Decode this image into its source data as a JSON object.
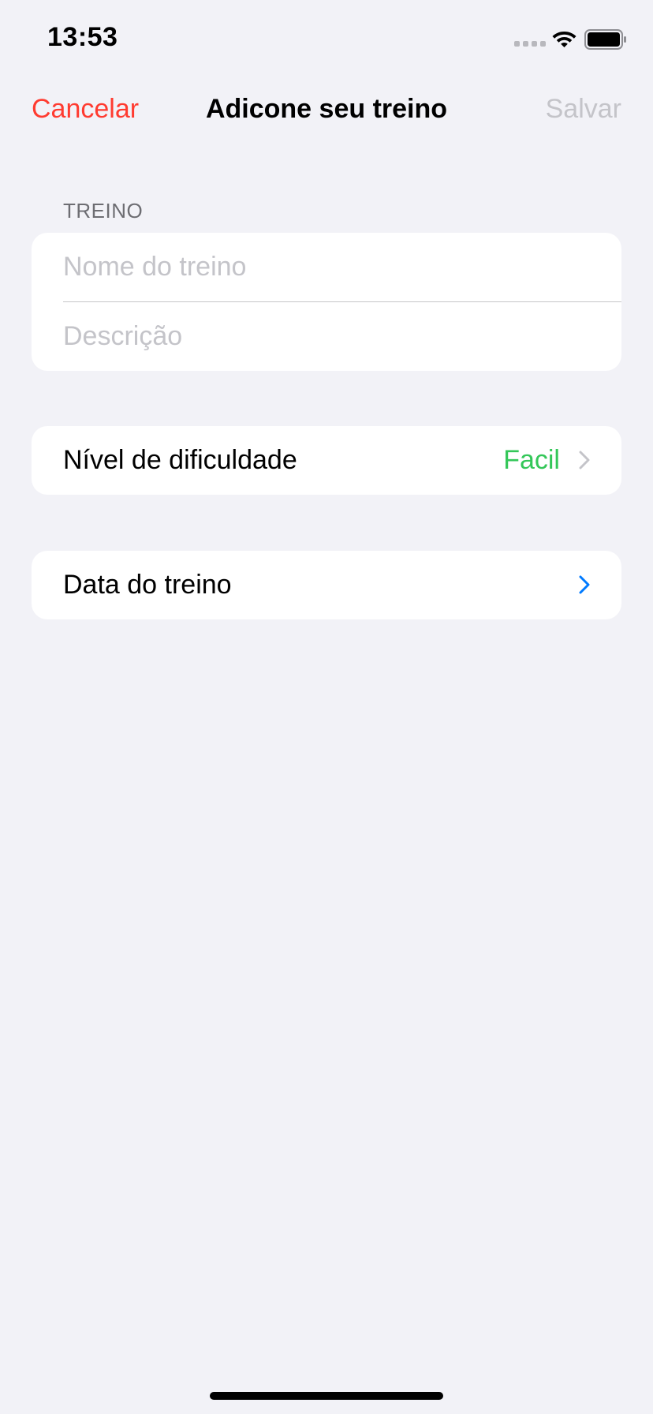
{
  "status_bar": {
    "time": "13:53",
    "icons": [
      "cellular-signal-icon",
      "wifi-icon",
      "battery-icon"
    ]
  },
  "nav": {
    "cancel_label": "Cancelar",
    "title": "Adicone seu treino",
    "save_label": "Salvar"
  },
  "section": {
    "header": "TREINO",
    "name_placeholder": "Nome do treino",
    "description_placeholder": "Descrição"
  },
  "difficulty_row": {
    "label": "Nível de dificuldade",
    "value": "Facil"
  },
  "date_row": {
    "label": "Data do treino"
  },
  "colors": {
    "background": "#f2f2f7",
    "cancel": "#ff3b30",
    "save_disabled": "#c4c4c9",
    "difficulty_value": "#34c759",
    "chevron_gray": "#c4c4c9",
    "chevron_blue": "#007aff"
  }
}
